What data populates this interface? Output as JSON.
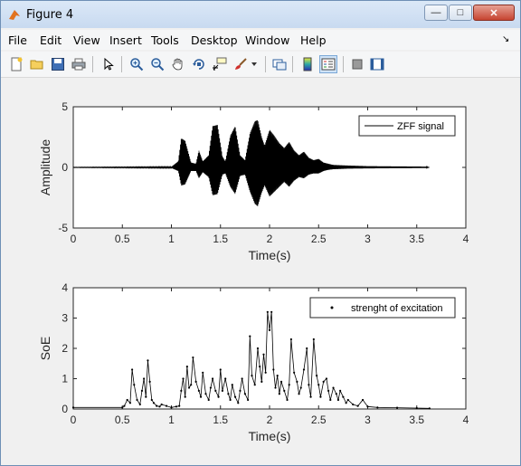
{
  "window": {
    "title": "Figure 4",
    "minimize_glyph": "—",
    "maximize_glyph": "□",
    "close_glyph": "✕"
  },
  "menubar": {
    "items": [
      "File",
      "Edit",
      "View",
      "Insert",
      "Tools",
      "Desktop",
      "Window",
      "Help"
    ],
    "dock_glyph": "↘"
  },
  "toolbar": {
    "buttons": [
      "new-figure-icon",
      "open-file-icon",
      "save-icon",
      "print-icon",
      "select-arrow-icon",
      "zoom-in-icon",
      "zoom-out-icon",
      "pan-hand-icon",
      "rotate-3d-icon",
      "data-cursor-icon",
      "brush-icon",
      "brush-dropdown-icon",
      "link-plot-icon",
      "insert-colorbar-icon",
      "insert-legend-icon",
      "hide-plot-tools-icon",
      "show-plot-tools-icon"
    ]
  },
  "colors": {
    "axes_bg": "#ffffff",
    "figure_bg": "#f0f0f0",
    "line": "#000000",
    "title_gradient_top": "#dbe8f7"
  },
  "chart_data": [
    {
      "type": "line",
      "title": "",
      "xlabel": "Time(s)",
      "ylabel": "Amplitude",
      "xlim": [
        0,
        4
      ],
      "ylim": [
        -5,
        5
      ],
      "xticks": [
        "0",
        "0.5",
        "1",
        "1.5",
        "2",
        "2.5",
        "3",
        "3.5",
        "4"
      ],
      "yticks": [
        "5",
        "0",
        "-5"
      ],
      "legend": {
        "entries": [
          "ZFF signal"
        ],
        "placement": "top-right"
      },
      "series": [
        {
          "name": "ZFF signal",
          "envelope": {
            "t": [
              0,
              1.0,
              1.07,
              1.1,
              1.14,
              1.2,
              1.25,
              1.28,
              1.32,
              1.38,
              1.42,
              1.47,
              1.52,
              1.55,
              1.6,
              1.65,
              1.7,
              1.75,
              1.8,
              1.85,
              1.88,
              1.92,
              1.95,
              2.0,
              2.05,
              2.1,
              2.15,
              2.2,
              2.25,
              2.3,
              2.35,
              2.4,
              2.45,
              2.5,
              2.55,
              2.6,
              2.65,
              2.8,
              3.0,
              3.3,
              3.6,
              3.63
            ],
            "upper": [
              0.02,
              0.05,
              0.5,
              2.4,
              2.2,
              0.4,
              0.3,
              1.4,
              0.5,
              1.0,
              3.4,
              3.5,
              0.9,
              0.5,
              2.6,
              3.4,
              1.0,
              0.6,
              2.8,
              3.8,
              3.9,
              2.5,
              1.8,
              3.1,
              2.6,
              2.0,
              1.6,
              2.1,
              1.4,
              1.0,
              1.3,
              0.8,
              0.6,
              0.7,
              0.4,
              0.3,
              0.2,
              0.15,
              0.1,
              0.08,
              0.06,
              0.0
            ],
            "lower": [
              -0.02,
              -0.05,
              -0.3,
              -1.5,
              -1.4,
              -0.3,
              -0.3,
              -0.9,
              -0.4,
              -0.8,
              -2.3,
              -2.2,
              -0.6,
              -0.5,
              -1.6,
              -2.2,
              -0.7,
              -0.6,
              -2.0,
              -3.0,
              -3.2,
              -2.1,
              -1.5,
              -2.4,
              -2.0,
              -1.6,
              -1.2,
              -1.6,
              -1.1,
              -0.8,
              -0.9,
              -0.6,
              -0.5,
              -0.5,
              -0.3,
              -0.2,
              -0.15,
              -0.1,
              -0.08,
              -0.06,
              -0.05,
              0.0
            ]
          }
        }
      ]
    },
    {
      "type": "line",
      "title": "",
      "xlabel": "Time(s)",
      "ylabel": "SoE",
      "xlim": [
        0,
        4
      ],
      "ylim": [
        0,
        4
      ],
      "xticks": [
        "0",
        "0.5",
        "1",
        "1.5",
        "2",
        "2.5",
        "3",
        "3.5",
        "4"
      ],
      "yticks": [
        "4",
        "3",
        "2",
        "1",
        "0"
      ],
      "legend": {
        "entries": [
          "strenght of excitation"
        ],
        "placement": "top-right"
      },
      "series": [
        {
          "name": "strenght of excitation",
          "x": [
            0,
            0.5,
            0.52,
            0.55,
            0.58,
            0.6,
            0.62,
            0.65,
            0.68,
            0.7,
            0.72,
            0.74,
            0.76,
            0.78,
            0.8,
            0.82,
            0.85,
            0.88,
            0.9,
            0.95,
            1.0,
            1.05,
            1.08,
            1.1,
            1.12,
            1.14,
            1.16,
            1.18,
            1.2,
            1.22,
            1.25,
            1.28,
            1.3,
            1.32,
            1.35,
            1.38,
            1.4,
            1.42,
            1.45,
            1.48,
            1.5,
            1.52,
            1.55,
            1.58,
            1.6,
            1.62,
            1.65,
            1.68,
            1.7,
            1.72,
            1.75,
            1.78,
            1.8,
            1.82,
            1.85,
            1.88,
            1.9,
            1.92,
            1.94,
            1.96,
            1.98,
            2.0,
            2.02,
            2.04,
            2.06,
            2.08,
            2.1,
            2.12,
            2.15,
            2.18,
            2.2,
            2.22,
            2.25,
            2.28,
            2.3,
            2.32,
            2.35,
            2.38,
            2.4,
            2.42,
            2.45,
            2.48,
            2.5,
            2.52,
            2.55,
            2.58,
            2.6,
            2.62,
            2.65,
            2.68,
            2.7,
            2.72,
            2.75,
            2.78,
            2.8,
            2.85,
            2.9,
            2.95,
            3.0,
            3.1,
            3.3,
            3.5,
            3.63
          ],
          "y": [
            0.05,
            0.05,
            0.1,
            0.3,
            0.2,
            1.3,
            0.8,
            0.3,
            0.15,
            0.6,
            1.0,
            0.4,
            1.6,
            0.9,
            0.3,
            0.2,
            0.1,
            0.08,
            0.15,
            0.1,
            0.05,
            0.08,
            0.1,
            0.6,
            1.0,
            0.4,
            1.4,
            0.7,
            0.8,
            1.7,
            0.9,
            0.6,
            0.4,
            1.2,
            0.5,
            0.3,
            0.7,
            1.0,
            0.6,
            0.4,
            1.3,
            0.6,
            1.0,
            0.5,
            0.3,
            0.8,
            0.4,
            0.2,
            0.6,
            1.0,
            0.5,
            0.3,
            2.4,
            1.1,
            0.8,
            2.0,
            1.4,
            0.9,
            1.8,
            1.2,
            3.2,
            2.6,
            3.2,
            1.3,
            0.7,
            1.1,
            0.5,
            0.9,
            0.6,
            0.3,
            0.8,
            2.3,
            1.2,
            0.9,
            0.5,
            0.7,
            1.3,
            2.0,
            0.8,
            0.4,
            2.3,
            1.1,
            0.8,
            0.4,
            0.9,
            1.0,
            0.6,
            0.3,
            0.7,
            0.5,
            0.3,
            0.6,
            0.4,
            0.2,
            0.3,
            0.15,
            0.1,
            0.3,
            0.08,
            0.05,
            0.04,
            0.03,
            0.02
          ]
        }
      ]
    }
  ]
}
